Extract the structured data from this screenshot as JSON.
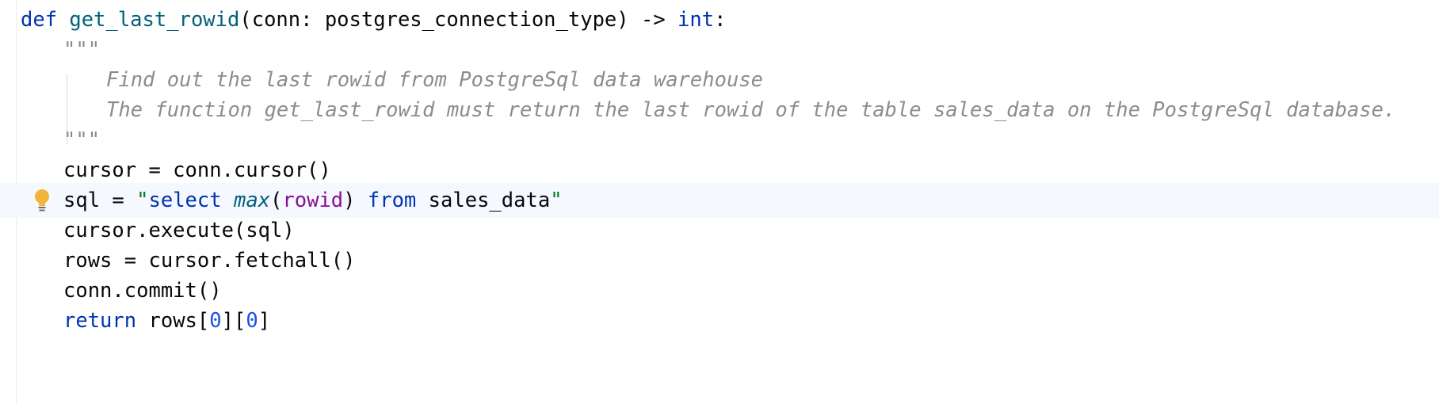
{
  "editor": {
    "language": "python",
    "colors": {
      "keyword": "#0033b3",
      "function_name": "#00627a",
      "string": "#067d17",
      "number": "#1750eb",
      "docstring": "#8c8c8c",
      "sql_column": "#871094",
      "current_line": "#f5f8fe",
      "intention_bulb": "#f2b53b"
    },
    "line1": {
      "kw_def": "def",
      "fn_name": "get_last_rowid",
      "params": "(conn: postgres_connection_type) -> ",
      "type_int": "int",
      "colon": ":"
    },
    "line2": {
      "docquote": "\"\"\""
    },
    "line3": {
      "doc": "Find out the last rowid from PostgreSql data warehouse"
    },
    "line4": {
      "doc": "The function get_last_rowid must return the last rowid of the table sales_data on the PostgreSql database."
    },
    "line5": {
      "docquote": "\"\"\""
    },
    "line6": {
      "code": "cursor = conn.cursor()"
    },
    "line7": {
      "prefix": "sql = ",
      "quote_open": "\"",
      "sql_select": "select",
      "sql_max": "max",
      "paren_open": "(",
      "sql_rowid": "rowid",
      "paren_close": ")",
      "sql_from": "from",
      "sql_table": "sales_data",
      "quote_close": "\"",
      "intention_icon": "lightbulb-icon"
    },
    "line8": {
      "code": "cursor.execute(sql)"
    },
    "line9": {
      "code": "rows = cursor.fetchall()"
    },
    "line10": {
      "code": "conn.commit()"
    },
    "line11": {
      "kw_return": "return",
      "rows": "rows",
      "bracket_open_1": "[",
      "idx_1": "0",
      "bracket_mid": "][",
      "idx_2": "0",
      "bracket_close": "]"
    }
  }
}
